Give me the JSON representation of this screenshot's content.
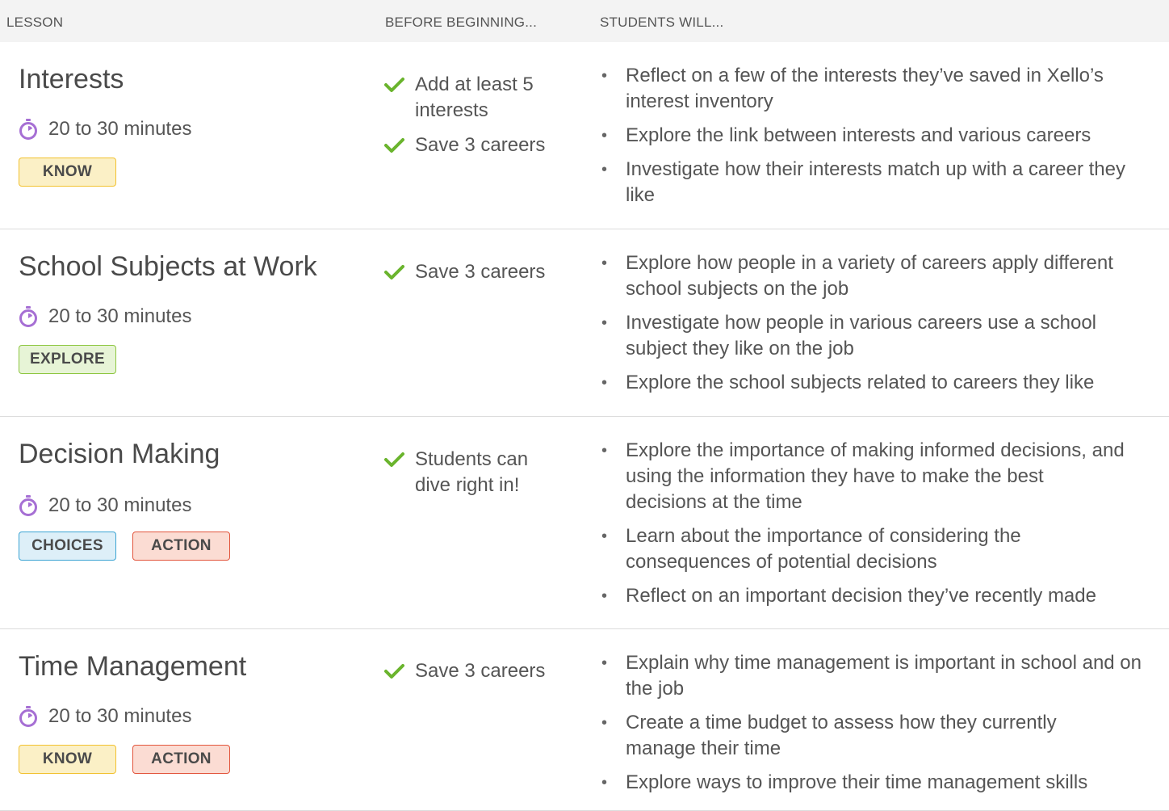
{
  "header": {
    "lesson": "LESSON",
    "before": "BEFORE BEGINNING...",
    "students": "STUDENTS WILL..."
  },
  "icons": {
    "timer": "stopwatch-icon",
    "check": "checkmark-icon",
    "timer_color": "#a66fd4",
    "check_color": "#6ab42d"
  },
  "lessons": [
    {
      "title": "Interests",
      "duration": "20 to 30 minutes",
      "tags": [
        "KNOW"
      ],
      "prerequisites": [
        "Add at least 5 interests",
        "Save 3 careers"
      ],
      "objectives": [
        "Reflect on a few of the interests they’ve saved in Xello’s interest inventory",
        "Explore the link between interests and various careers",
        "Investigate how their interests match up with a career they like"
      ]
    },
    {
      "title": "School Subjects at Work",
      "duration": "20 to 30 minutes",
      "tags": [
        "EXPLORE"
      ],
      "prerequisites": [
        "Save 3 careers"
      ],
      "objectives": [
        "Explore how people in a variety of careers apply different school subjects on the job",
        "Investigate how people in various careers use a school subject they like on the job",
        "Explore the school subjects related to careers they like"
      ]
    },
    {
      "title": "Decision Making",
      "duration": "20 to 30 minutes",
      "tags": [
        "CHOICES",
        "ACTION"
      ],
      "prerequisites": [
        "Students can dive right in!"
      ],
      "objectives": [
        "Explore the importance of making informed decisions, and using the information they have to make the best decisions at the time",
        "Learn about the importance of considering the consequences of potential decisions",
        "Reflect on an important decision they’ve recently made"
      ]
    },
    {
      "title": "Time Management",
      "duration": "20 to 30 minutes",
      "tags": [
        "KNOW",
        "ACTION"
      ],
      "prerequisites": [
        "Save 3 careers"
      ],
      "objectives": [
        "Explain why time management is important in school and on the job",
        "Create a time budget to assess how they currently manage their time",
        "Explore ways to improve their time management skills"
      ]
    }
  ]
}
